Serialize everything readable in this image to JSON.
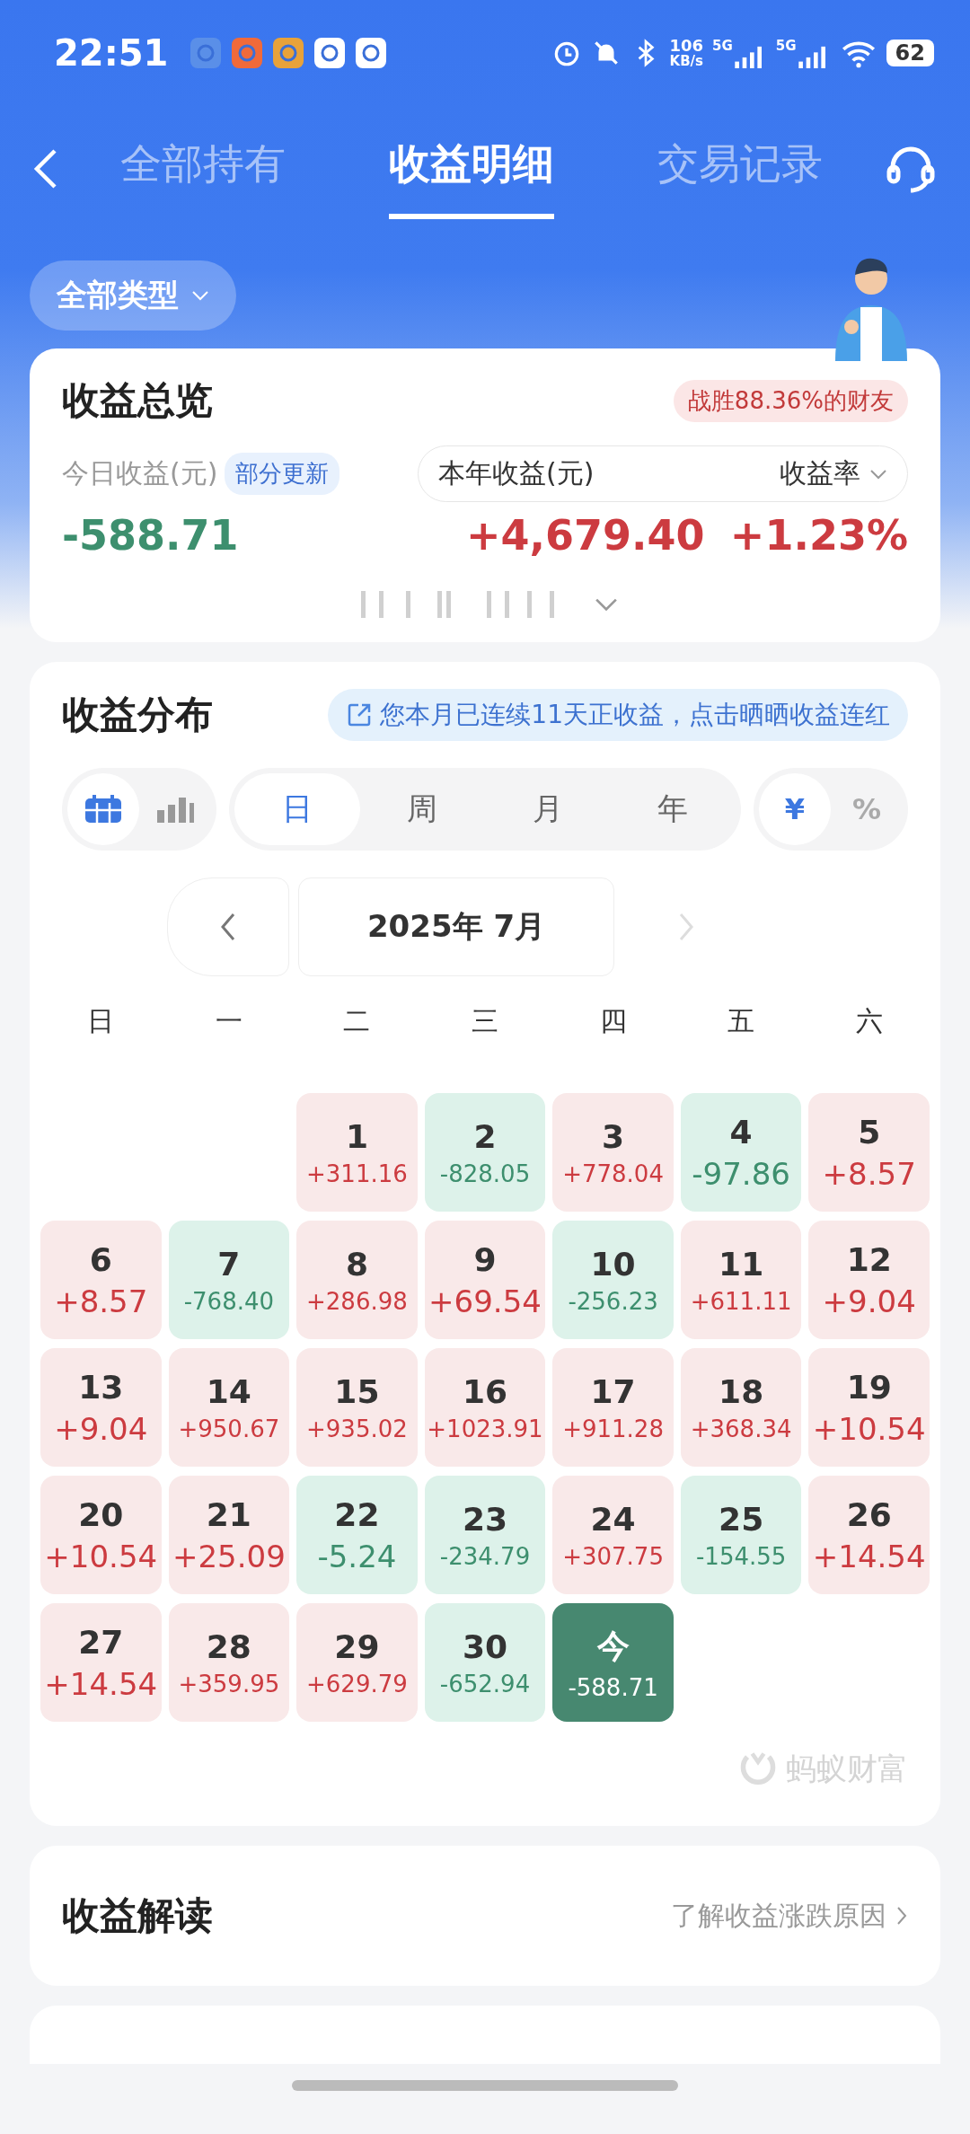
{
  "status_bar": {
    "time": "22:51",
    "net_speed": "106",
    "net_unit": "KB/s",
    "sim1": "5G",
    "sim2": "5G",
    "battery": "62"
  },
  "tabs": [
    {
      "label": "全部持有",
      "selected": false
    },
    {
      "label": "收益明细",
      "selected": true
    },
    {
      "label": "交易记录",
      "selected": false
    }
  ],
  "filter": {
    "label": "全部类型"
  },
  "overview": {
    "title": "收益总览",
    "badge": "战胜88.36%的财友",
    "today_label": "今日收益(元)",
    "today_tag": "部分更新",
    "today_value": "-588.71",
    "year_label": "本年收益(元)",
    "rate_label": "收益率",
    "year_value": "+4,679.40",
    "rate_value": "+1.23%"
  },
  "distribution": {
    "title": "收益分布",
    "banner": "您本月已连续11天正收益，点击晒晒收益连红",
    "views": [
      {
        "kind": "calendar",
        "selected": true
      },
      {
        "kind": "bars",
        "selected": false
      }
    ],
    "periods": [
      {
        "label": "日",
        "selected": true
      },
      {
        "label": "周",
        "selected": false
      },
      {
        "label": "月",
        "selected": false
      },
      {
        "label": "年",
        "selected": false
      }
    ],
    "units": [
      {
        "label": "¥",
        "selected": true
      },
      {
        "label": "%",
        "selected": false
      }
    ],
    "month": "2025年 7月",
    "weekdays": [
      "日",
      "一",
      "二",
      "三",
      "四",
      "五",
      "六"
    ],
    "weeks": [
      [
        {
          "kind": "blank"
        },
        {
          "kind": "blank"
        },
        {
          "day": "1",
          "value": "+311.16",
          "kind": "gain"
        },
        {
          "day": "2",
          "value": "-828.05",
          "kind": "loss"
        },
        {
          "day": "3",
          "value": "+778.04",
          "kind": "gain"
        },
        {
          "day": "4",
          "value": "-97.86",
          "kind": "loss"
        },
        {
          "day": "5",
          "value": "+8.57",
          "kind": "gain"
        }
      ],
      [
        {
          "day": "6",
          "value": "+8.57",
          "kind": "gain"
        },
        {
          "day": "7",
          "value": "-768.40",
          "kind": "loss"
        },
        {
          "day": "8",
          "value": "+286.98",
          "kind": "gain"
        },
        {
          "day": "9",
          "value": "+69.54",
          "kind": "gain"
        },
        {
          "day": "10",
          "value": "-256.23",
          "kind": "loss"
        },
        {
          "day": "11",
          "value": "+611.11",
          "kind": "gain"
        },
        {
          "day": "12",
          "value": "+9.04",
          "kind": "gain"
        }
      ],
      [
        {
          "day": "13",
          "value": "+9.04",
          "kind": "gain"
        },
        {
          "day": "14",
          "value": "+950.67",
          "kind": "gain"
        },
        {
          "day": "15",
          "value": "+935.02",
          "kind": "gain"
        },
        {
          "day": "16",
          "value": "+1023.91",
          "kind": "gain"
        },
        {
          "day": "17",
          "value": "+911.28",
          "kind": "gain"
        },
        {
          "day": "18",
          "value": "+368.34",
          "kind": "gain"
        },
        {
          "day": "19",
          "value": "+10.54",
          "kind": "gain"
        }
      ],
      [
        {
          "day": "20",
          "value": "+10.54",
          "kind": "gain"
        },
        {
          "day": "21",
          "value": "+25.09",
          "kind": "gain"
        },
        {
          "day": "22",
          "value": "-5.24",
          "kind": "loss"
        },
        {
          "day": "23",
          "value": "-234.79",
          "kind": "loss"
        },
        {
          "day": "24",
          "value": "+307.75",
          "kind": "gain"
        },
        {
          "day": "25",
          "value": "-154.55",
          "kind": "loss"
        },
        {
          "day": "26",
          "value": "+14.54",
          "kind": "gain"
        }
      ],
      [
        {
          "day": "27",
          "value": "+14.54",
          "kind": "gain"
        },
        {
          "day": "28",
          "value": "+359.95",
          "kind": "gain"
        },
        {
          "day": "29",
          "value": "+629.79",
          "kind": "gain"
        },
        {
          "day": "30",
          "value": "-652.94",
          "kind": "loss"
        },
        {
          "day": "今",
          "value": "-588.71",
          "kind": "today"
        }
      ]
    ],
    "brand": "蚂蚁财富"
  },
  "analysis": {
    "title": "收益解读",
    "link": "了解收益涨跌原因"
  }
}
